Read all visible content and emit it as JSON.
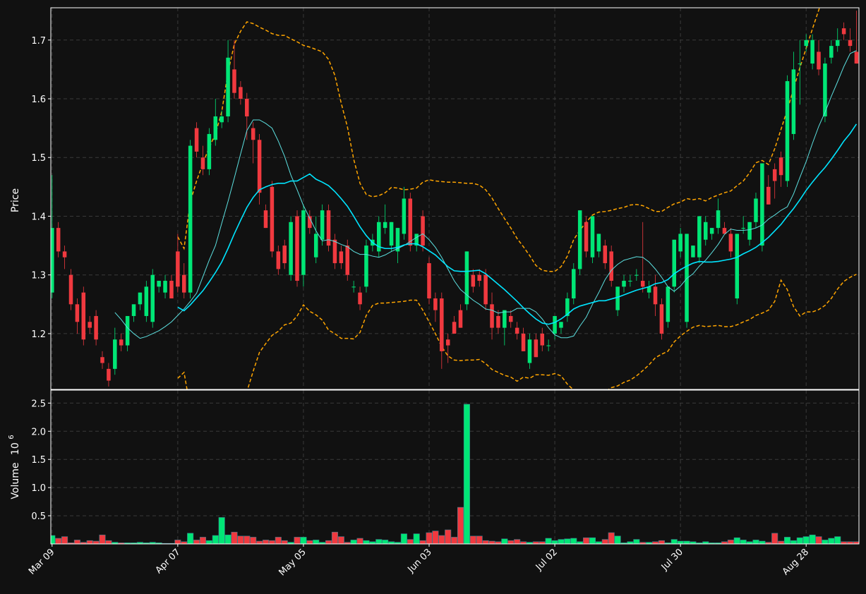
{
  "chart_data": {
    "type": "candlestick",
    "price_panel": {
      "ylabel": "Price",
      "ylim": [
        1.105,
        1.755
      ],
      "yticks": [
        1.2,
        1.3,
        1.4,
        1.5,
        1.6,
        1.7
      ],
      "ytick_labels": [
        "1.2",
        "1.3",
        "1.4",
        "1.5",
        "1.6",
        "1.7"
      ],
      "grid": true
    },
    "volume_panel": {
      "ylabel": "Volume",
      "ylabel_exponent": "10",
      "ylabel_exponent_power": "6",
      "ylim": [
        0,
        2.73
      ],
      "yticks": [
        0.5,
        1.0,
        1.5,
        2.0,
        2.5
      ],
      "ytick_labels": [
        "0.5",
        "1.0",
        "1.5",
        "2.0",
        "2.5"
      ],
      "unit": "millions"
    },
    "x_ticks": [
      {
        "index": 0,
        "label": "Mar 09"
      },
      {
        "index": 20,
        "label": "Apr 07"
      },
      {
        "index": 40,
        "label": "May 05"
      },
      {
        "index": 60,
        "label": "Jun 03"
      },
      {
        "index": 80,
        "label": "Jul 02"
      },
      {
        "index": 100,
        "label": "Jul 30"
      },
      {
        "index": 120,
        "label": "Aug 28"
      }
    ],
    "colors": {
      "up": "#00e676",
      "down": "#f0393f",
      "sma_fast": "#5ce0e0",
      "sma_slow": "#00e5ff",
      "bands": "#ffa500",
      "background": "#111111",
      "grid": "#3a3a3a",
      "frame": "#ffffff"
    },
    "candles": [
      [
        1.27,
        1.47,
        1.26,
        1.38
      ],
      [
        1.38,
        1.39,
        1.33,
        1.34
      ],
      [
        1.34,
        1.35,
        1.31,
        1.33
      ],
      [
        1.3,
        1.31,
        1.24,
        1.25
      ],
      [
        1.25,
        1.26,
        1.2,
        1.22
      ],
      [
        1.27,
        1.28,
        1.18,
        1.19
      ],
      [
        1.22,
        1.23,
        1.2,
        1.21
      ],
      [
        1.23,
        1.24,
        1.18,
        1.19
      ],
      [
        1.16,
        1.17,
        1.14,
        1.15
      ],
      [
        1.14,
        1.15,
        1.11,
        1.12
      ],
      [
        1.14,
        1.21,
        1.13,
        1.19
      ],
      [
        1.19,
        1.2,
        1.17,
        1.18
      ],
      [
        1.18,
        1.23,
        1.17,
        1.23
      ],
      [
        1.23,
        1.25,
        1.22,
        1.25
      ],
      [
        1.25,
        1.27,
        1.24,
        1.27
      ],
      [
        1.23,
        1.29,
        1.22,
        1.28
      ],
      [
        1.22,
        1.31,
        1.21,
        1.3
      ],
      [
        1.28,
        1.29,
        1.27,
        1.29
      ],
      [
        1.27,
        1.3,
        1.26,
        1.29
      ],
      [
        1.29,
        1.3,
        1.26,
        1.26
      ],
      [
        1.34,
        1.37,
        1.27,
        1.28
      ],
      [
        1.3,
        1.32,
        1.26,
        1.27
      ],
      [
        1.27,
        1.53,
        1.26,
        1.52
      ],
      [
        1.55,
        1.56,
        1.5,
        1.51
      ],
      [
        1.5,
        1.52,
        1.47,
        1.48
      ],
      [
        1.48,
        1.55,
        1.47,
        1.54
      ],
      [
        1.53,
        1.6,
        1.52,
        1.57
      ],
      [
        1.56,
        1.58,
        1.55,
        1.57
      ],
      [
        1.57,
        1.7,
        1.56,
        1.67
      ],
      [
        1.65,
        1.7,
        1.6,
        1.61
      ],
      [
        1.62,
        1.63,
        1.59,
        1.6
      ],
      [
        1.6,
        1.61,
        1.53,
        1.57
      ],
      [
        1.55,
        1.56,
        1.49,
        1.53
      ],
      [
        1.53,
        1.54,
        1.42,
        1.44
      ],
      [
        1.41,
        1.42,
        1.38,
        1.38
      ],
      [
        1.45,
        1.46,
        1.33,
        1.34
      ],
      [
        1.34,
        1.35,
        1.3,
        1.31
      ],
      [
        1.35,
        1.36,
        1.31,
        1.32
      ],
      [
        1.3,
        1.4,
        1.29,
        1.39
      ],
      [
        1.4,
        1.41,
        1.28,
        1.29
      ],
      [
        1.3,
        1.42,
        1.28,
        1.41
      ],
      [
        1.4,
        1.41,
        1.37,
        1.38
      ],
      [
        1.33,
        1.4,
        1.32,
        1.37
      ],
      [
        1.36,
        1.42,
        1.35,
        1.41
      ],
      [
        1.41,
        1.42,
        1.34,
        1.35
      ],
      [
        1.36,
        1.37,
        1.31,
        1.32
      ],
      [
        1.34,
        1.35,
        1.31,
        1.32
      ],
      [
        1.35,
        1.36,
        1.29,
        1.3
      ],
      [
        1.28,
        1.29,
        1.27,
        1.28
      ],
      [
        1.27,
        1.28,
        1.24,
        1.25
      ],
      [
        1.28,
        1.36,
        1.27,
        1.35
      ],
      [
        1.35,
        1.37,
        1.34,
        1.36
      ],
      [
        1.34,
        1.4,
        1.33,
        1.39
      ],
      [
        1.38,
        1.42,
        1.37,
        1.39
      ],
      [
        1.35,
        1.39,
        1.34,
        1.39
      ],
      [
        1.34,
        1.38,
        1.32,
        1.38
      ],
      [
        1.37,
        1.45,
        1.36,
        1.43
      ],
      [
        1.43,
        1.44,
        1.34,
        1.35
      ],
      [
        1.35,
        1.37,
        1.34,
        1.37
      ],
      [
        1.4,
        1.41,
        1.34,
        1.35
      ],
      [
        1.32,
        1.33,
        1.25,
        1.26
      ],
      [
        1.26,
        1.27,
        1.22,
        1.24
      ],
      [
        1.26,
        1.27,
        1.14,
        1.17
      ],
      [
        1.19,
        1.2,
        1.15,
        1.18
      ],
      [
        1.22,
        1.23,
        1.2,
        1.2
      ],
      [
        1.24,
        1.25,
        1.21,
        1.21
      ],
      [
        1.25,
        1.34,
        1.24,
        1.34
      ],
      [
        1.3,
        1.31,
        1.27,
        1.28
      ],
      [
        1.3,
        1.31,
        1.28,
        1.29
      ],
      [
        1.3,
        1.31,
        1.24,
        1.25
      ],
      [
        1.25,
        1.27,
        1.19,
        1.21
      ],
      [
        1.23,
        1.24,
        1.2,
        1.21
      ],
      [
        1.21,
        1.24,
        1.18,
        1.24
      ],
      [
        1.23,
        1.24,
        1.21,
        1.22
      ],
      [
        1.21,
        1.22,
        1.19,
        1.2
      ],
      [
        1.2,
        1.21,
        1.17,
        1.17
      ],
      [
        1.15,
        1.2,
        1.14,
        1.19
      ],
      [
        1.19,
        1.2,
        1.16,
        1.16
      ],
      [
        1.2,
        1.21,
        1.17,
        1.18
      ],
      [
        1.18,
        1.19,
        1.17,
        1.18
      ],
      [
        1.2,
        1.23,
        1.19,
        1.23
      ],
      [
        1.21,
        1.22,
        1.2,
        1.22
      ],
      [
        1.23,
        1.27,
        1.22,
        1.26
      ],
      [
        1.26,
        1.32,
        1.25,
        1.31
      ],
      [
        1.31,
        1.41,
        1.3,
        1.41
      ],
      [
        1.39,
        1.4,
        1.33,
        1.34
      ],
      [
        1.33,
        1.4,
        1.32,
        1.4
      ],
      [
        1.34,
        1.37,
        1.33,
        1.37
      ],
      [
        1.35,
        1.36,
        1.31,
        1.32
      ],
      [
        1.34,
        1.35,
        1.28,
        1.29
      ],
      [
        1.24,
        1.28,
        1.23,
        1.28
      ],
      [
        1.28,
        1.3,
        1.27,
        1.29
      ],
      [
        1.29,
        1.3,
        1.28,
        1.29
      ],
      [
        1.3,
        1.31,
        1.29,
        1.3
      ],
      [
        1.29,
        1.39,
        1.27,
        1.28
      ],
      [
        1.27,
        1.29,
        1.26,
        1.28
      ],
      [
        1.28,
        1.3,
        1.23,
        1.25
      ],
      [
        1.25,
        1.26,
        1.19,
        1.2
      ],
      [
        1.22,
        1.28,
        1.21,
        1.28
      ],
      [
        1.28,
        1.36,
        1.27,
        1.36
      ],
      [
        1.34,
        1.38,
        1.33,
        1.37
      ],
      [
        1.22,
        1.37,
        1.21,
        1.37
      ],
      [
        1.33,
        1.35,
        1.33,
        1.35
      ],
      [
        1.33,
        1.4,
        1.32,
        1.4
      ],
      [
        1.36,
        1.4,
        1.35,
        1.39
      ],
      [
        1.37,
        1.38,
        1.36,
        1.38
      ],
      [
        1.38,
        1.43,
        1.37,
        1.41
      ],
      [
        1.38,
        1.39,
        1.37,
        1.37
      ],
      [
        1.37,
        1.38,
        1.33,
        1.34
      ],
      [
        1.26,
        1.37,
        1.25,
        1.37
      ],
      [
        1.38,
        1.4,
        1.37,
        1.38
      ],
      [
        1.36,
        1.39,
        1.35,
        1.39
      ],
      [
        1.39,
        1.44,
        1.38,
        1.43
      ],
      [
        1.35,
        1.49,
        1.34,
        1.49
      ],
      [
        1.45,
        1.47,
        1.42,
        1.42
      ],
      [
        1.48,
        1.49,
        1.43,
        1.46
      ],
      [
        1.5,
        1.51,
        1.45,
        1.47
      ],
      [
        1.46,
        1.64,
        1.45,
        1.63
      ],
      [
        1.54,
        1.68,
        1.53,
        1.65
      ],
      [
        1.66,
        1.7,
        1.59,
        1.66
      ],
      [
        1.69,
        1.71,
        1.68,
        1.7
      ],
      [
        1.66,
        1.71,
        1.65,
        1.7
      ],
      [
        1.68,
        1.7,
        1.64,
        1.65
      ],
      [
        1.57,
        1.67,
        1.56,
        1.66
      ],
      [
        1.67,
        1.7,
        1.66,
        1.69
      ],
      [
        1.69,
        1.72,
        1.68,
        1.7
      ],
      [
        1.72,
        1.73,
        1.7,
        1.71
      ],
      [
        1.7,
        1.72,
        1.68,
        1.69
      ],
      [
        1.68,
        1.75,
        1.66,
        1.66
      ]
    ],
    "volume": [
      0.15,
      0.1,
      0.13,
      0.02,
      0.07,
      0.03,
      0.06,
      0.05,
      0.16,
      0.06,
      0.03,
      0.02,
      0.02,
      0.02,
      0.03,
      0.02,
      0.03,
      0.02,
      0.01,
      0.01,
      0.07,
      0.04,
      0.19,
      0.07,
      0.12,
      0.06,
      0.15,
      0.47,
      0.16,
      0.21,
      0.14,
      0.14,
      0.12,
      0.05,
      0.07,
      0.06,
      0.12,
      0.06,
      0.03,
      0.12,
      0.12,
      0.06,
      0.07,
      0.03,
      0.06,
      0.21,
      0.13,
      0.03,
      0.07,
      0.1,
      0.06,
      0.04,
      0.08,
      0.07,
      0.04,
      0.03,
      0.18,
      0.08,
      0.18,
      0.06,
      0.2,
      0.23,
      0.15,
      0.25,
      0.12,
      0.65,
      2.48,
      0.14,
      0.14,
      0.06,
      0.05,
      0.04,
      0.09,
      0.06,
      0.08,
      0.04,
      0.03,
      0.04,
      0.04,
      0.1,
      0.06,
      0.08,
      0.09,
      0.1,
      0.04,
      0.11,
      0.11,
      0.04,
      0.08,
      0.2,
      0.14,
      0.02,
      0.04,
      0.08,
      0.03,
      0.03,
      0.04,
      0.06,
      0.02,
      0.08,
      0.05,
      0.05,
      0.04,
      0.02,
      0.04,
      0.02,
      0.02,
      0.04,
      0.07,
      0.11,
      0.07,
      0.04,
      0.07,
      0.05,
      0.03,
      0.19,
      0.05,
      0.12,
      0.06,
      0.11,
      0.13,
      0.16,
      0.13,
      0.07,
      0.1,
      0.13,
      0.04,
      0.04,
      0.04
    ],
    "sma_fast": [
      null,
      null,
      null,
      null,
      null,
      null,
      null,
      null,
      null,
      null,
      1.236,
      1.224,
      1.21,
      1.2,
      1.192,
      1.195,
      1.2,
      1.205,
      1.212,
      1.22,
      1.231,
      1.242,
      1.255,
      1.269,
      1.297,
      1.325,
      1.35,
      1.388,
      1.425,
      1.465,
      1.506,
      1.546,
      1.564,
      1.564,
      1.558,
      1.55,
      1.528,
      1.502,
      1.47,
      1.445,
      1.418,
      1.397,
      1.375,
      1.358,
      1.36,
      1.357,
      1.352,
      1.348,
      1.34,
      1.335,
      1.335,
      1.332,
      1.33,
      1.334,
      1.34,
      1.345,
      1.35,
      1.357,
      1.364,
      1.37,
      1.36,
      1.347,
      1.33,
      1.31,
      1.29,
      1.275,
      1.266,
      1.257,
      1.25,
      1.242,
      1.24,
      1.235,
      1.237,
      1.237,
      1.243,
      1.243,
      1.243,
      1.237,
      1.225,
      1.21,
      1.198,
      1.193,
      1.193,
      1.196,
      1.213,
      1.228,
      1.25,
      1.27,
      1.292,
      1.308,
      1.318,
      1.325,
      1.328,
      1.331,
      1.33,
      1.322,
      1.31,
      1.296,
      1.28,
      1.272,
      1.281,
      1.294,
      1.302,
      1.315,
      1.325,
      1.338,
      1.352,
      1.369,
      1.378,
      1.376,
      1.376,
      1.377,
      1.38,
      1.385,
      1.395,
      1.402,
      1.41,
      1.416,
      1.438,
      1.466,
      1.493,
      1.524,
      1.553,
      1.577,
      1.604,
      1.629,
      1.655,
      1.677,
      1.682
    ],
    "sma_slow": [
      null,
      null,
      null,
      null,
      null,
      null,
      null,
      null,
      null,
      null,
      null,
      null,
      null,
      null,
      null,
      null,
      null,
      null,
      null,
      null,
      1.245,
      1.239,
      1.249,
      1.261,
      1.273,
      1.288,
      1.304,
      1.322,
      1.345,
      1.37,
      1.393,
      1.415,
      1.432,
      1.445,
      1.45,
      1.454,
      1.456,
      1.456,
      1.46,
      1.46,
      1.466,
      1.472,
      1.463,
      1.458,
      1.452,
      1.442,
      1.43,
      1.417,
      1.4,
      1.382,
      1.367,
      1.355,
      1.348,
      1.345,
      1.345,
      1.347,
      1.351,
      1.353,
      1.353,
      1.348,
      1.341,
      1.334,
      1.324,
      1.314,
      1.307,
      1.306,
      1.306,
      1.307,
      1.308,
      1.302,
      1.293,
      1.284,
      1.275,
      1.265,
      1.255,
      1.244,
      1.234,
      1.225,
      1.218,
      1.216,
      1.219,
      1.225,
      1.233,
      1.242,
      1.247,
      1.25,
      1.253,
      1.256,
      1.256,
      1.259,
      1.262,
      1.266,
      1.27,
      1.274,
      1.277,
      1.28,
      1.285,
      1.287,
      1.292,
      1.302,
      1.309,
      1.315,
      1.32,
      1.323,
      1.322,
      1.322,
      1.323,
      1.325,
      1.327,
      1.33,
      1.336,
      1.341,
      1.347,
      1.355,
      1.364,
      1.375,
      1.386,
      1.4,
      1.413,
      1.428,
      1.444,
      1.458,
      1.471,
      1.483,
      1.497,
      1.512,
      1.528,
      1.541,
      1.557
    ],
    "band_upper": [
      null,
      null,
      null,
      null,
      null,
      null,
      null,
      null,
      null,
      null,
      null,
      null,
      null,
      null,
      null,
      null,
      null,
      null,
      null,
      null,
      1.365,
      1.345,
      1.425,
      1.46,
      1.49,
      1.517,
      1.54,
      1.578,
      1.645,
      1.693,
      1.715,
      1.731,
      1.728,
      1.722,
      1.717,
      1.711,
      1.708,
      1.708,
      1.702,
      1.697,
      1.691,
      1.688,
      1.684,
      1.68,
      1.667,
      1.64,
      1.593,
      1.552,
      1.497,
      1.456,
      1.437,
      1.433,
      1.435,
      1.44,
      1.449,
      1.448,
      1.445,
      1.446,
      1.448,
      1.458,
      1.462,
      1.46,
      1.459,
      1.458,
      1.458,
      1.457,
      1.456,
      1.456,
      1.453,
      1.445,
      1.431,
      1.413,
      1.396,
      1.38,
      1.362,
      1.348,
      1.333,
      1.316,
      1.308,
      1.306,
      1.306,
      1.314,
      1.332,
      1.36,
      1.376,
      1.39,
      1.402,
      1.407,
      1.408,
      1.41,
      1.413,
      1.415,
      1.419,
      1.42,
      1.418,
      1.413,
      1.408,
      1.408,
      1.415,
      1.421,
      1.424,
      1.43,
      1.428,
      1.43,
      1.426,
      1.432,
      1.436,
      1.44,
      1.443,
      1.452,
      1.46,
      1.474,
      1.491,
      1.495,
      1.488,
      1.515,
      1.548,
      1.581,
      1.617,
      1.653,
      1.686,
      1.719,
      1.751,
      1.785,
      1.82,
      1.85,
      1.88,
      1.9,
      1.92
    ],
    "band_lower": [
      null,
      null,
      null,
      null,
      null,
      null,
      null,
      null,
      null,
      null,
      null,
      null,
      null,
      null,
      null,
      null,
      null,
      null,
      null,
      null,
      1.124,
      1.134,
      1.073,
      1.062,
      1.056,
      1.059,
      1.068,
      1.066,
      1.045,
      1.047,
      1.071,
      1.101,
      1.136,
      1.168,
      1.183,
      1.197,
      1.204,
      1.215,
      1.218,
      1.23,
      1.249,
      1.238,
      1.232,
      1.223,
      1.206,
      1.2,
      1.192,
      1.192,
      1.191,
      1.202,
      1.231,
      1.248,
      1.252,
      1.252,
      1.253,
      1.254,
      1.255,
      1.257,
      1.257,
      1.24,
      1.22,
      1.2,
      1.178,
      1.162,
      1.155,
      1.154,
      1.155,
      1.155,
      1.156,
      1.149,
      1.139,
      1.134,
      1.129,
      1.126,
      1.119,
      1.126,
      1.124,
      1.13,
      1.13,
      1.129,
      1.132,
      1.128,
      1.114,
      1.104,
      1.103,
      1.1,
      1.098,
      1.098,
      1.101,
      1.108,
      1.111,
      1.117,
      1.121,
      1.128,
      1.137,
      1.147,
      1.159,
      1.165,
      1.17,
      1.186,
      1.196,
      1.204,
      1.211,
      1.214,
      1.212,
      1.213,
      1.214,
      1.212,
      1.212,
      1.215,
      1.22,
      1.224,
      1.231,
      1.235,
      1.24,
      1.255,
      1.291,
      1.275,
      1.246,
      1.23,
      1.237,
      1.237,
      1.241,
      1.248,
      1.26,
      1.276,
      1.289,
      1.296,
      1.301
    ]
  }
}
